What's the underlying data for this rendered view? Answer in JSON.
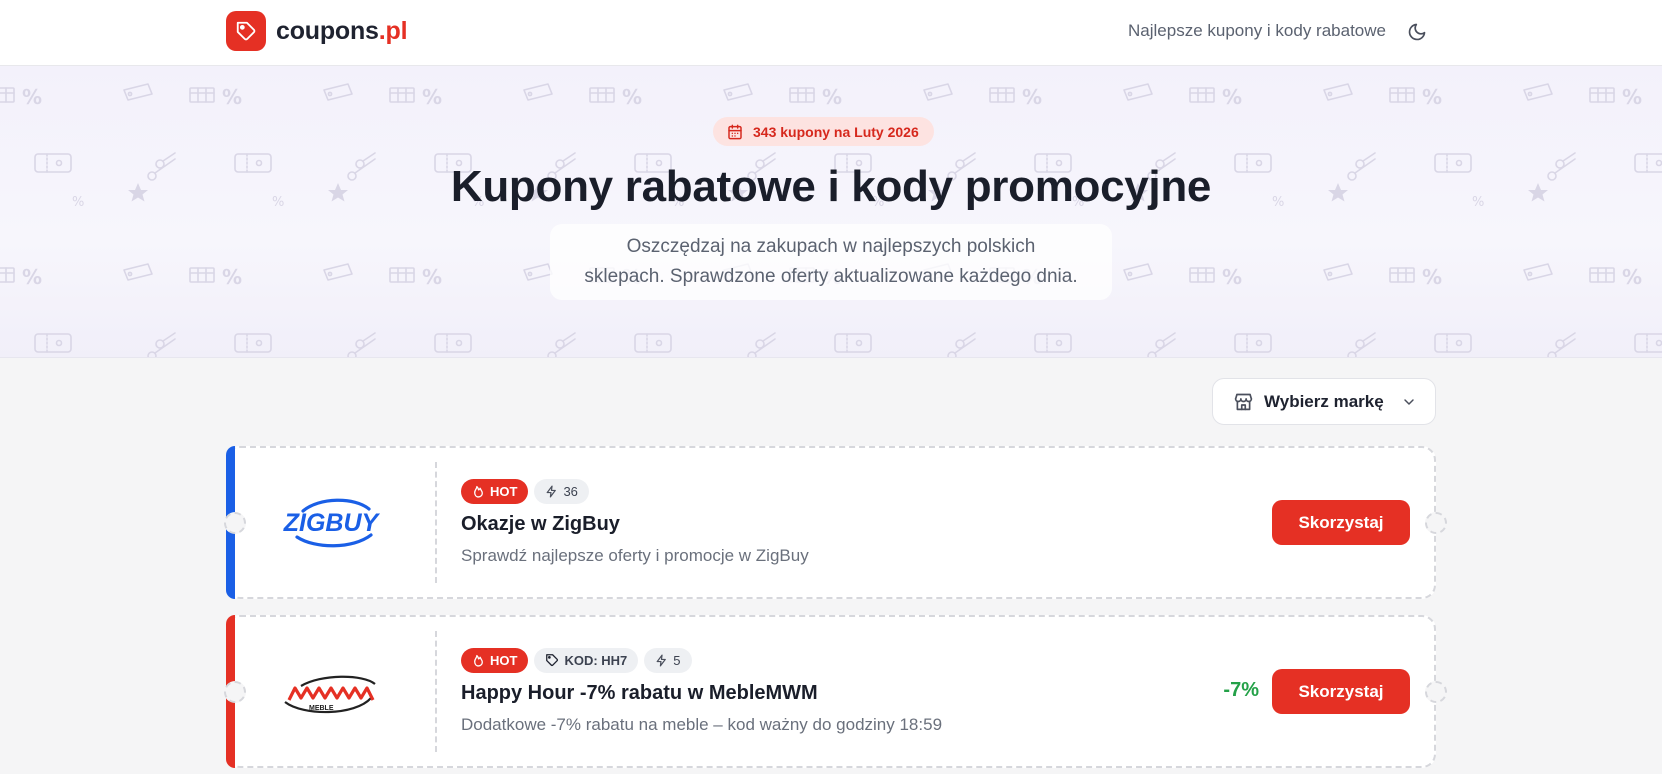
{
  "header": {
    "logo_main": "coupons",
    "logo_tld": ".pl",
    "tagline": "Najlepsze kupony i kody rabatowe"
  },
  "hero": {
    "badge": "343 kupony na Luty 2026",
    "title": "Kupony rabatowe i kody promocyjne",
    "subtitle_line1": "Oszczędzaj na zakupach w najlepszych polskich",
    "subtitle_line2": "sklepach. Sprawdzone oferty aktualizowane każdego dnia."
  },
  "filter": {
    "brand_select_label": "Wybierz markę"
  },
  "coupons": [
    {
      "brand": "ZIGBUY",
      "accent_color": "#1a5fe6",
      "hot_label": "HOT",
      "uses": "36",
      "title": "Okazje w ZigBuy",
      "description": "Sprawdź najlepsze oferty i promocje w ZigBuy",
      "cta": "Skorzystaj"
    },
    {
      "brand": "MWM",
      "brand_sub": "MEBLE",
      "accent_color": "#e53024",
      "hot_label": "HOT",
      "code_label": "KOD: HH7",
      "uses": "5",
      "title": "Happy Hour -7% rabatu w MebleMWM",
      "description": "Dodatkowe -7% rabatu na meble – kod ważny do godziny 18:59",
      "discount": "-7%",
      "cta": "Skorzystaj"
    }
  ],
  "colors": {
    "brand_red": "#e53024",
    "discount_green": "#24a148",
    "zigbuy_blue": "#1a5fe6"
  }
}
